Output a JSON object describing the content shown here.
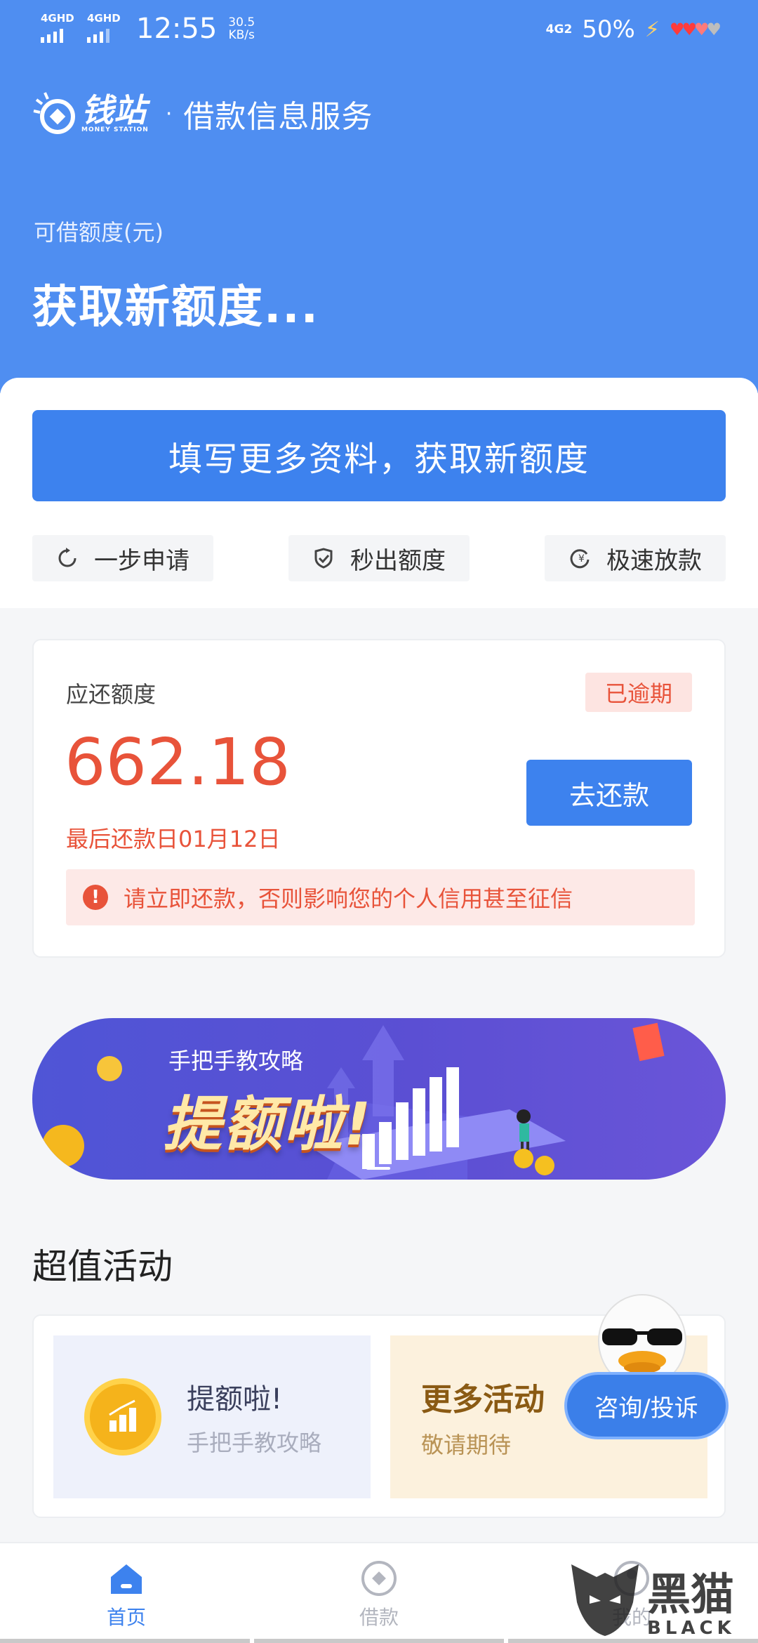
{
  "status_bar": {
    "signal1": "4GHD",
    "signal2": "4GHD",
    "time": "12:55",
    "speed_value": "30.5",
    "speed_unit": "KB/s",
    "network": "4G2",
    "battery": "50%"
  },
  "brand": {
    "logo_cn": "钱站",
    "logo_en": "MONEY STATION",
    "separator": "·",
    "subtitle": "借款信息服务"
  },
  "quota": {
    "label": "可借额度(元)",
    "value": "获取新额度..."
  },
  "cta_label": "填写更多资料，获取新额度",
  "features": [
    {
      "icon": "refresh-icon",
      "label": "一步申请"
    },
    {
      "icon": "shield-check-icon",
      "label": "秒出额度"
    },
    {
      "icon": "yen-cycle-icon",
      "label": "极速放款"
    }
  ],
  "repayment": {
    "title": "应还额度",
    "status": "已逾期",
    "amount": "662.18",
    "due_date": "最后还款日01月12日",
    "button": "去还款",
    "warning": "请立即还款，否则影响您的个人信用甚至征信"
  },
  "banner": {
    "subtitle": "手把手教攻略",
    "headline": "提额啦!"
  },
  "section_title": "超值活动",
  "activities": [
    {
      "title": "提额啦!",
      "subtitle": "手把手教攻略"
    },
    {
      "title": "更多活动",
      "subtitle": "敬请期待"
    }
  ],
  "consult_button": "咨询/投诉",
  "tabs": [
    {
      "label": "首页",
      "icon": "home-icon",
      "active": true
    },
    {
      "label": "借款",
      "icon": "loan-icon",
      "active": false
    },
    {
      "label": "我的",
      "icon": "user-icon",
      "active": false
    }
  ],
  "watermark": {
    "cn": "黑猫",
    "en": "BLACK CAT"
  },
  "colors": {
    "header_blue": "#4f8ef1",
    "primary_button": "#3d82ee",
    "overdue_red": "#e8533a",
    "banner_purple": "#5b4fd3"
  }
}
